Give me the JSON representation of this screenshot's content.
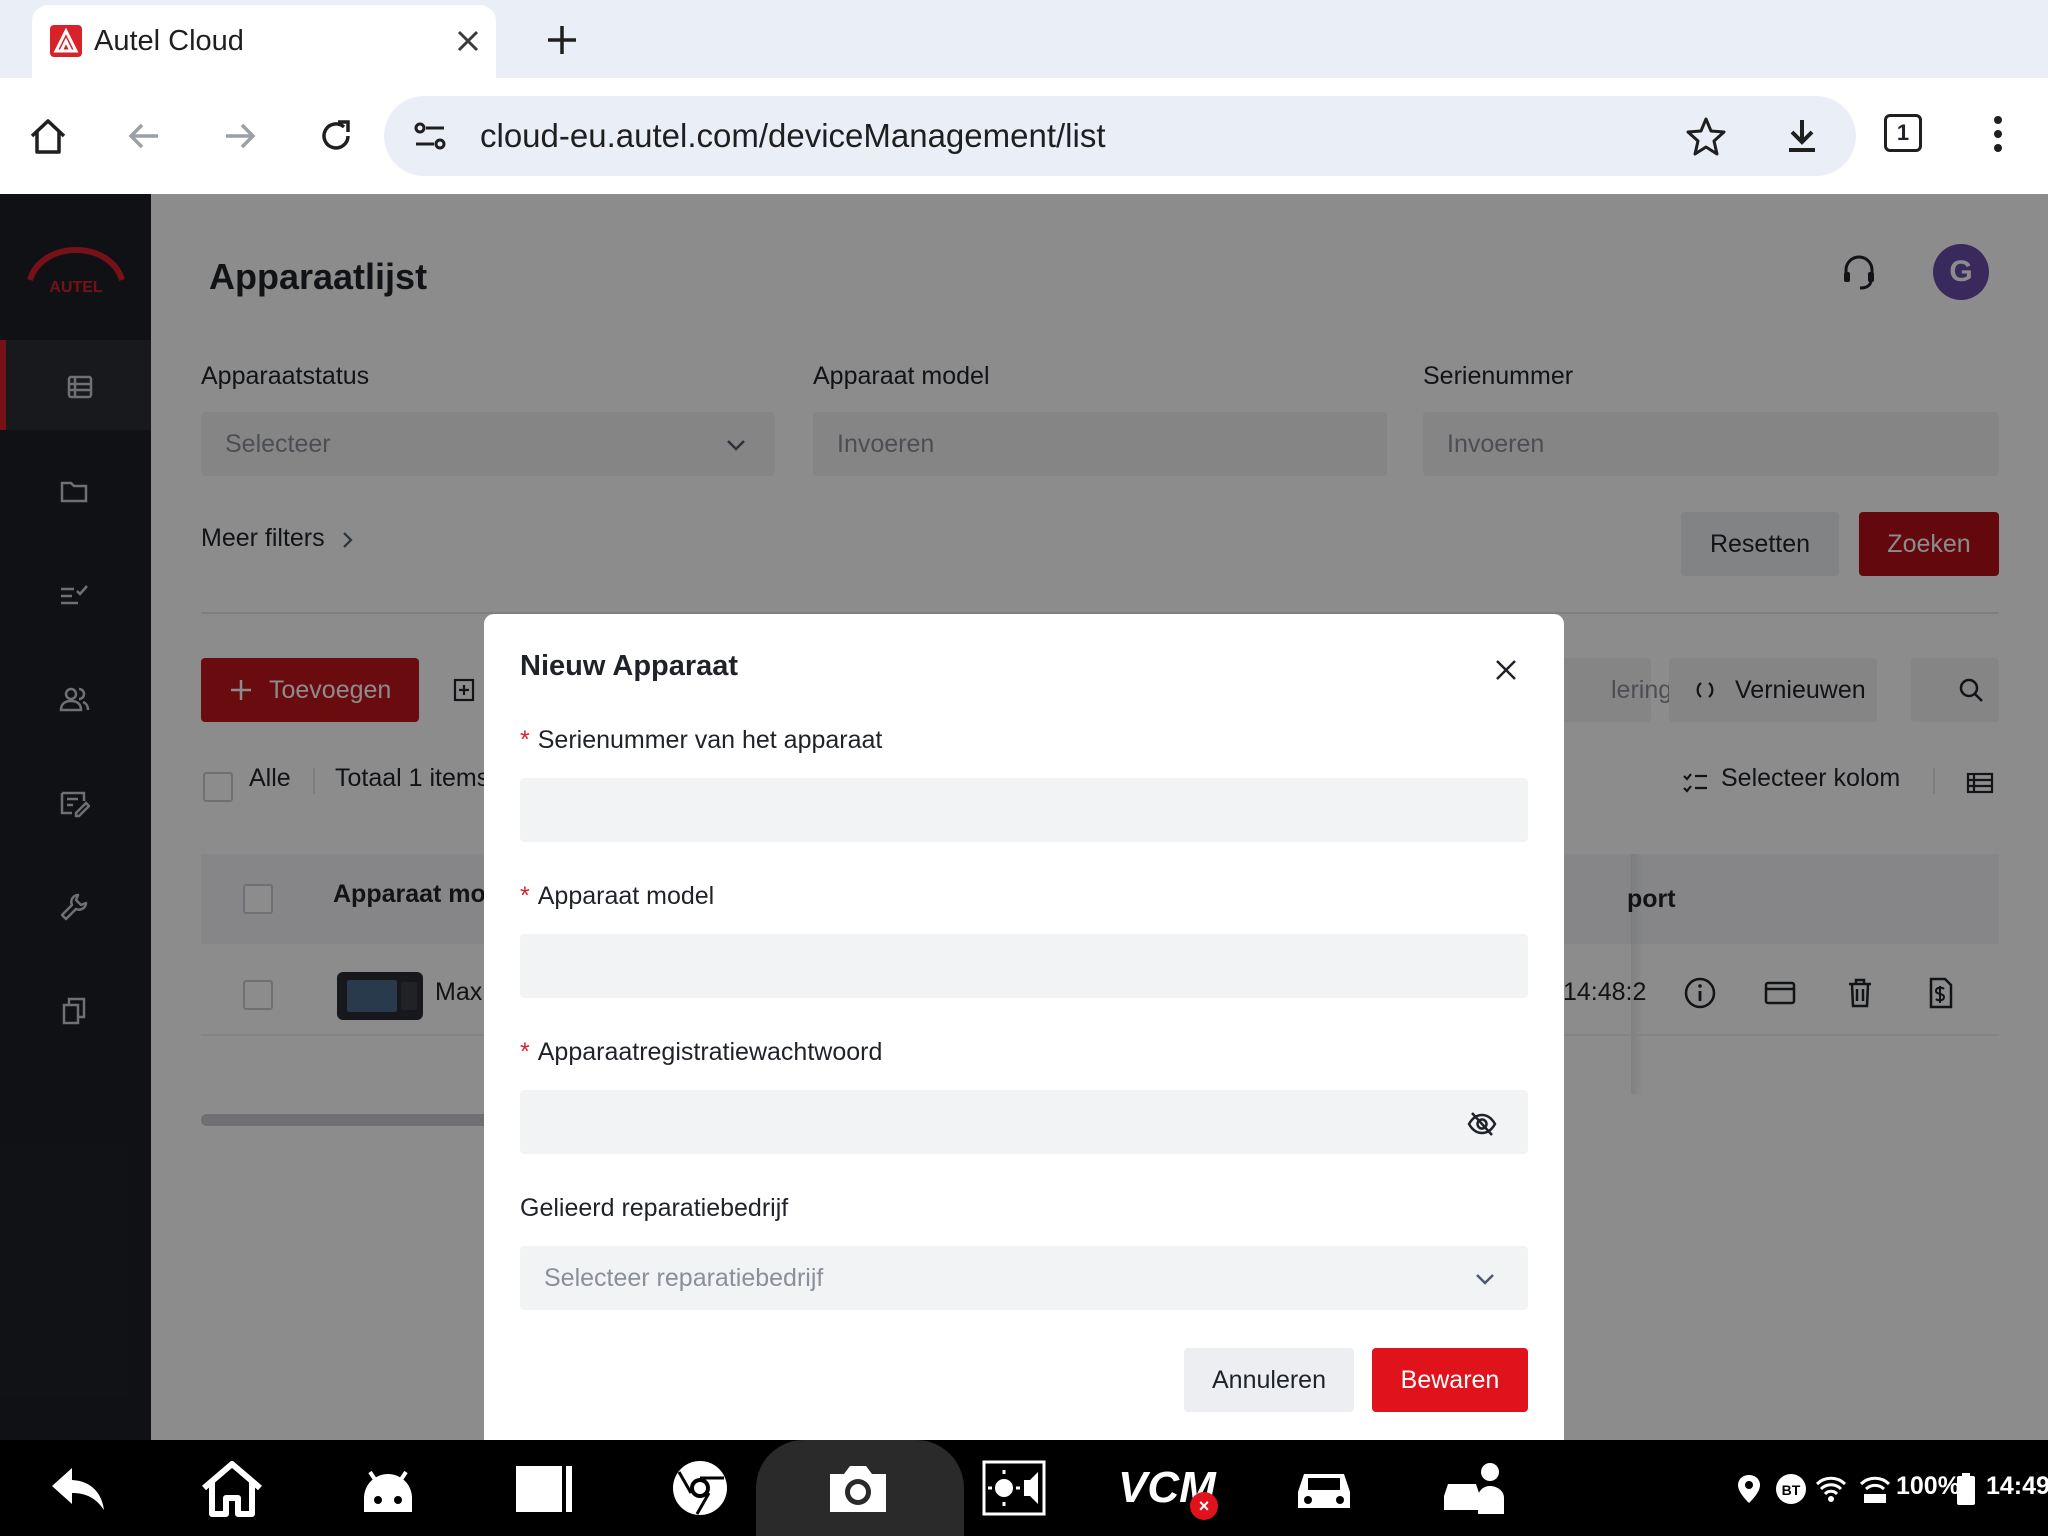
{
  "browser": {
    "tab_title": "Autel Cloud",
    "url": "cloud-eu.autel.com/deviceManagement/list",
    "tab_count": "1"
  },
  "app": {
    "logo_text": "AUTEL",
    "page_title": "Apparaatlijst",
    "avatar_initial": "G",
    "filters": {
      "status_label": "Apparaatstatus",
      "status_placeholder": "Selecteer",
      "model_label": "Apparaat model",
      "model_placeholder": "Invoeren",
      "serial_label": "Serienummer",
      "serial_placeholder": "Invoeren",
      "more_filters": "Meer filters",
      "reset": "Resetten",
      "search": "Zoeken"
    },
    "toolbar": {
      "add": "Toevoegen",
      "sort_partial": "lering",
      "renew": "Vernieuwen"
    },
    "list": {
      "select_all": "Alle",
      "total": "Totaal 1 items",
      "select_columns": "Selecteer kolom",
      "col_model": "Apparaat mod",
      "col_report_partial": "port",
      "row_model": "Max",
      "row_time": "14:48:2"
    }
  },
  "modal": {
    "title": "Nieuw Apparaat",
    "required_mark": "*",
    "serial_label": "Serienummer van het apparaat",
    "serial_value": "",
    "model_label": "Apparaat model",
    "model_value": "",
    "password_label": "Apparaatregistratiewachtwoord",
    "password_value": "",
    "workshop_label": "Gelieerd reparatiebedrijf",
    "workshop_placeholder": "Selecteer reparatiebedrijf",
    "cancel": "Annuleren",
    "save": "Bewaren"
  },
  "system_bar": {
    "vcm_label": "VCM",
    "vcm_badge": "×",
    "bt_label": "BT",
    "battery": "100%",
    "time": "14:49"
  },
  "colors": {
    "brand_red": "#d8222a",
    "primary_button": "#e0121c",
    "sidebar_bg": "#1d2026",
    "avatar": "#6b4ca8"
  }
}
